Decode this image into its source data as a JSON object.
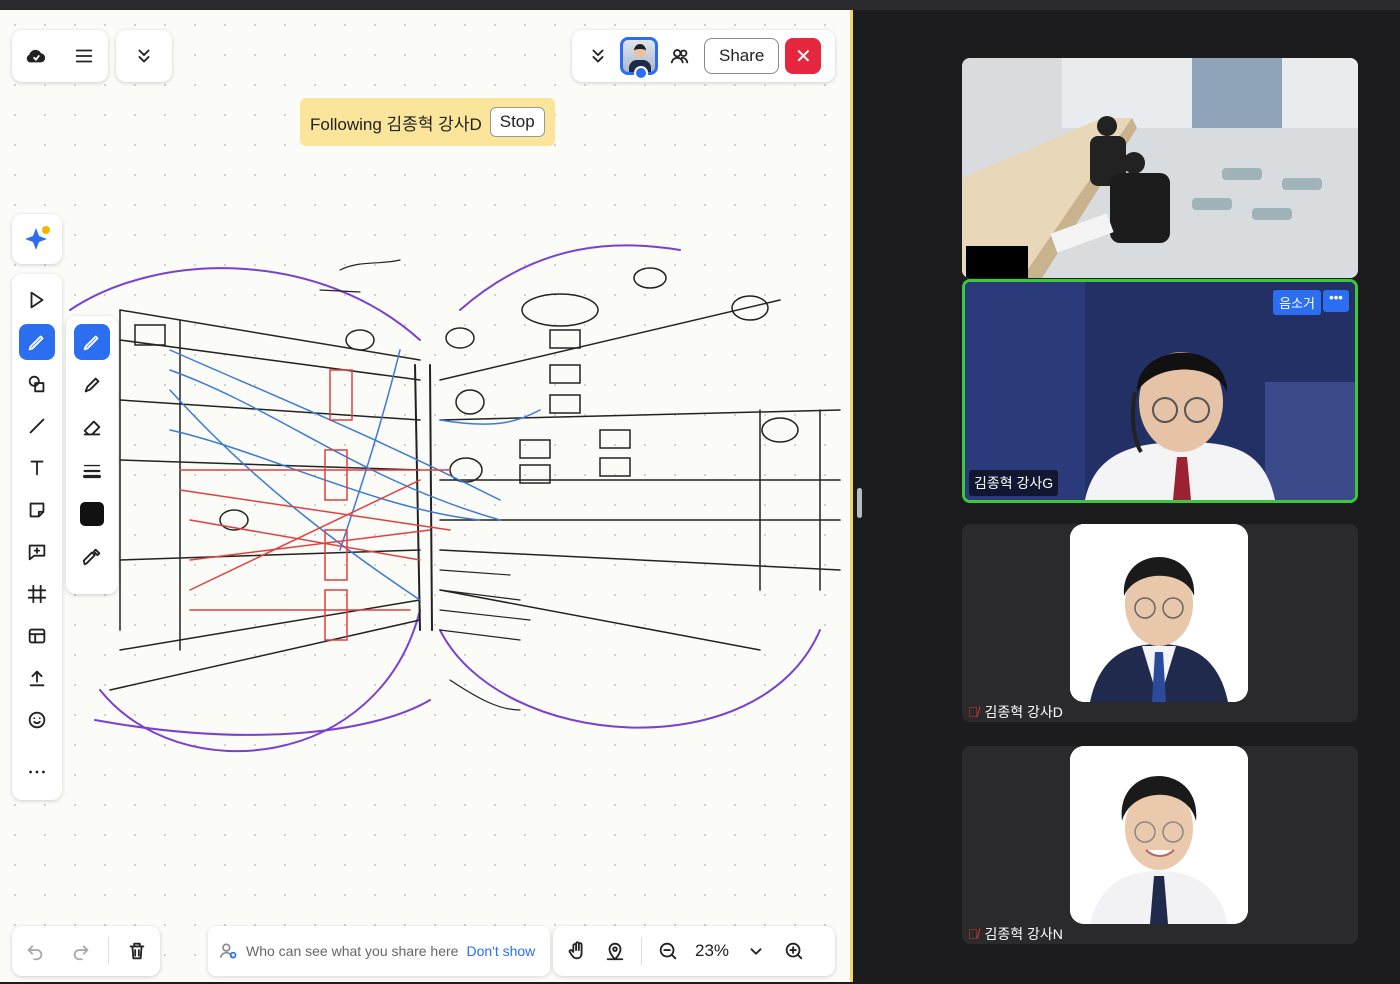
{
  "following": {
    "text": "Following 김종혁 강사D",
    "stop_label": "Stop"
  },
  "top_right": {
    "share_label": "Share"
  },
  "share_notice": {
    "text": "Who can see what you share here",
    "link": "Don't show"
  },
  "zoom": {
    "level": "23%"
  },
  "videos": [
    {
      "name": ""
    },
    {
      "name": "김종혁 강사G",
      "tag": "음소거",
      "more": "•••"
    },
    {
      "name": "김종혁 강사D"
    },
    {
      "name": "김종혁 강사N"
    }
  ],
  "colors": {
    "accent": "#2b6ff0",
    "close": "#e4263f",
    "follow_banner": "#fbe59a",
    "active_speaker": "#3ec73e"
  },
  "icons": [
    "cloud-icon",
    "menu-icon",
    "double-chevron-down-icon",
    "people-icon",
    "ai-sparkle-icon",
    "select-icon",
    "pen-icon",
    "shapes-icon",
    "line-icon",
    "text-icon",
    "sticky-note-icon",
    "comment-icon",
    "frame-icon",
    "template-icon",
    "upload-icon",
    "emoji-icon",
    "more-icon",
    "marker-icon",
    "eraser-icon",
    "stroke-width-icon",
    "color-swatch",
    "eyedropper-icon",
    "undo-icon",
    "redo-icon",
    "trash-icon",
    "hand-icon",
    "location-icon",
    "zoom-out-icon",
    "chevron-down-icon",
    "zoom-in-icon"
  ]
}
